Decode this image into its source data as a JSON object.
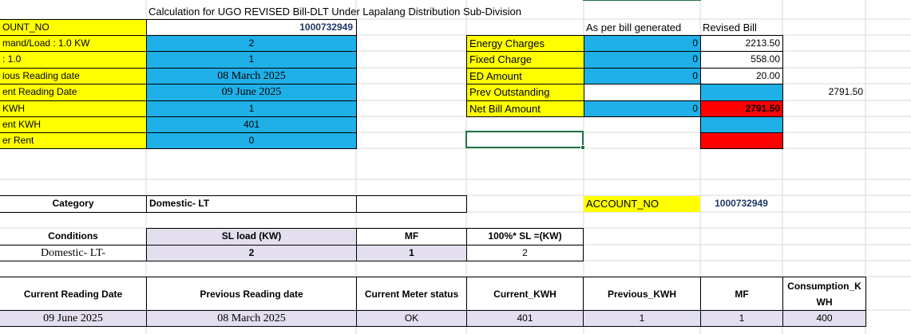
{
  "title": "Calculation for UGO REVISED Bill-DLT Under Lapalang Distribution Sub-Division",
  "account_no_top": "1000732949",
  "left_labels": [
    "OUNT_NO",
    "mand/Load : 1.0 KW",
    ": 1.0",
    "ious Reading date",
    "ent Reading Date",
    " KWH",
    "ent KWH",
    "er Rent"
  ],
  "left_values": [
    "",
    "2",
    "1",
    "08 March 2025",
    "09 June 2025",
    "1",
    "401",
    "0"
  ],
  "col_headers": {
    "as_per_bill": "As per bill generated",
    "revised": "Revised Bill"
  },
  "charges": [
    {
      "label": "Energy Charges",
      "as_per": "0",
      "revised": "2213.50"
    },
    {
      "label": "Fixed Charge",
      "as_per": "0",
      "revised": "558.00"
    },
    {
      "label": "ED Amount",
      "as_per": "0",
      "revised": "20.00"
    },
    {
      "label": "Prev Outstanding",
      "as_per": "",
      "revised": ""
    },
    {
      "label": "Net Bill Amount",
      "as_per": "0",
      "revised": "2791.50"
    }
  ],
  "outside_value": "2791.50",
  "category": {
    "label": "Category",
    "value": "Domestic- LT"
  },
  "account": {
    "label": "ACCOUNT_NO",
    "value": "1000732949"
  },
  "conditions": {
    "headers": [
      "Conditions",
      "SL load (KW)",
      "MF",
      "100%* SL =(KW)"
    ],
    "values": [
      "Domestic- LT-",
      "2",
      "1",
      "2"
    ]
  },
  "readings": {
    "headers": [
      "Current Reading Date",
      "Previous Reading date",
      "Current Meter status",
      "Current_KWH",
      "Previous_KWH",
      "MF",
      "Consumption_KWH"
    ],
    "values": [
      "09 June 2025",
      "08 March 2025",
      "OK",
      "401",
      "1",
      "1",
      "400"
    ]
  },
  "colors": {
    "yellow": "#ffff00",
    "blue": "#1fb0e8",
    "red": "#ff0000",
    "lavender": "#e4dfee",
    "selection": "#217346"
  }
}
